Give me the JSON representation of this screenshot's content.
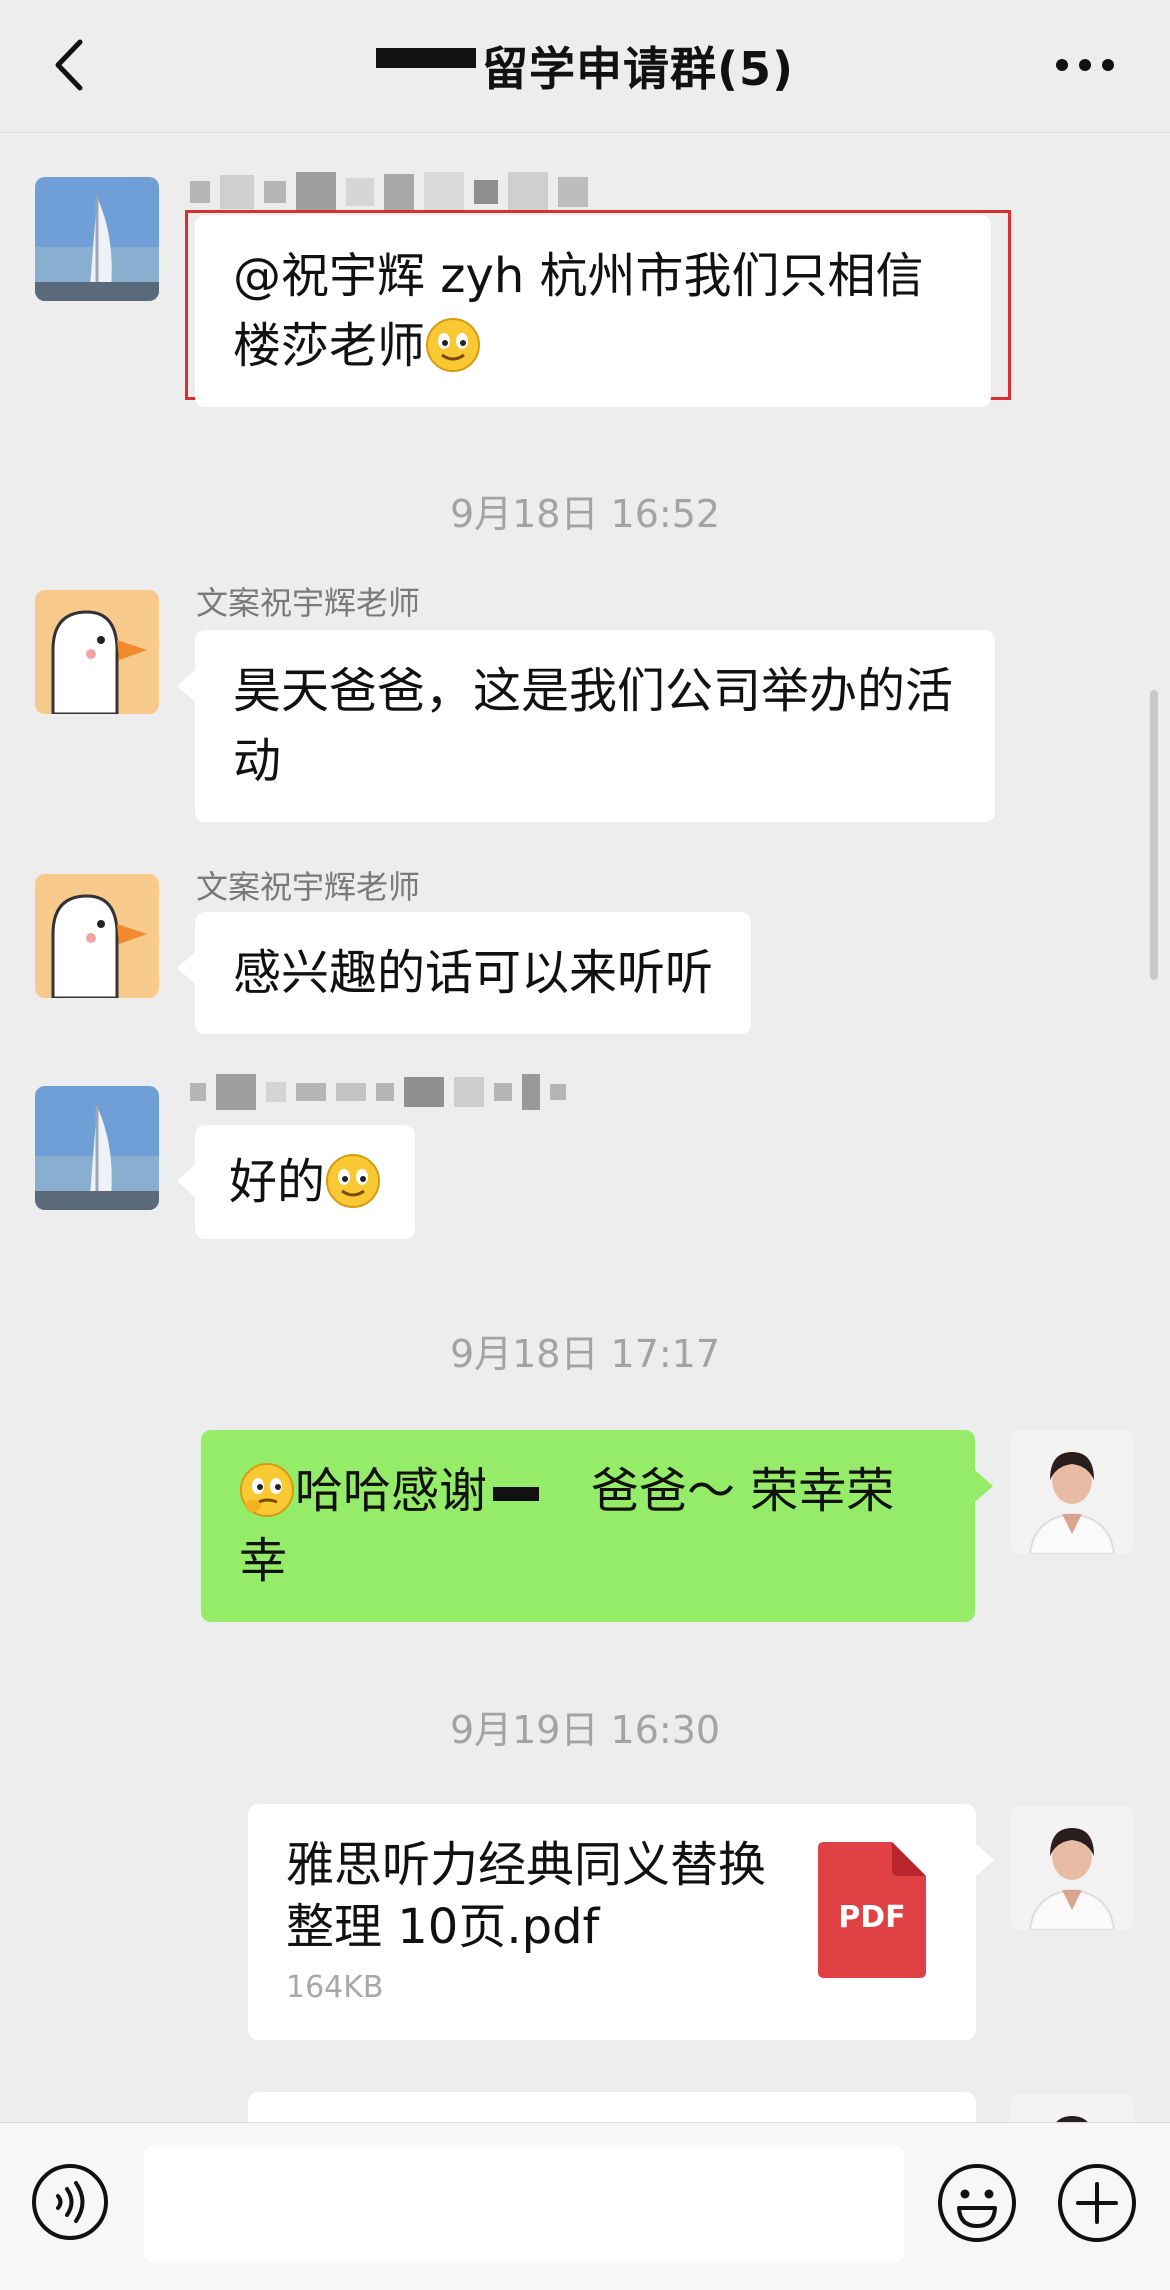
{
  "header": {
    "title": "留学申请群(5)"
  },
  "messages": [
    {
      "sender_name": "",
      "text": "@祝宇辉 zyh 杭州市我们只相信楼莎老师"
    },
    {
      "time": "9月18日 16:52"
    },
    {
      "sender_name": "文案祝宇辉老师",
      "text": "昊天爸爸，这是我们公司举办的活动"
    },
    {
      "sender_name": "文案祝宇辉老师",
      "text": "感兴趣的话可以来听听"
    },
    {
      "sender_name": "",
      "text": "好的"
    },
    {
      "time": "9月18日 17:17"
    },
    {
      "text_a": "哈哈感谢",
      "text_b": "爸爸～ 荣幸荣幸"
    },
    {
      "time": "9月19日 16:30"
    },
    {
      "file_name": "雅思听力经典同义替换整理 10页.pdf",
      "file_size": "164KB",
      "file_type": "PDF"
    }
  ],
  "icons": {
    "back": "chevron-left-icon",
    "more": "more-icon",
    "voice": "voice-icon",
    "emoji": "emoji-icon",
    "plus": "plus-icon"
  },
  "colors": {
    "background": "#ededed",
    "bubble_self": "#95ec69",
    "bubble_other": "#ffffff",
    "highlight_border": "#d83030",
    "pdf_red": "#e04145"
  }
}
